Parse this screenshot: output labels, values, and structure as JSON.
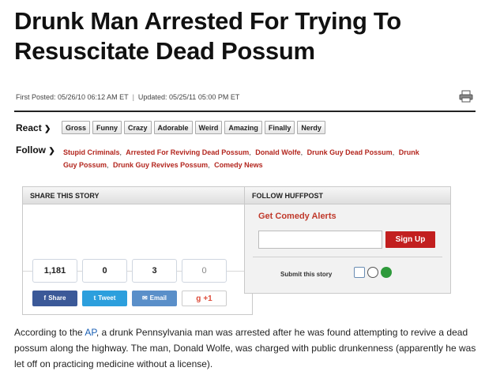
{
  "headline": "Drunk Man Arrested For Trying To Resuscitate Dead Possum",
  "dates": {
    "first_posted": "First Posted: 05/26/10 06:12 AM ET",
    "separator": "|",
    "updated": "Updated: 05/25/11 05:00 PM ET"
  },
  "react": {
    "label": "React",
    "arrow": "❯",
    "tags": [
      "Gross",
      "Funny",
      "Crazy",
      "Adorable",
      "Weird",
      "Amazing",
      "Finally",
      "Nerdy"
    ]
  },
  "follow": {
    "label": "Follow",
    "arrow": "❯",
    "links": [
      "Stupid Criminals",
      "Arrested For Reviving Dead Possum",
      "Donald Wolfe",
      "Drunk Guy Dead Possum",
      "Drunk Guy Possum",
      "Drunk Guy Revives Possum",
      "Comedy News"
    ]
  },
  "share": {
    "title": "SHARE THIS STORY",
    "counts": [
      "1,181",
      "0",
      "3",
      "0"
    ],
    "buttons": [
      {
        "label": "Share",
        "icon_glyph": "f",
        "icon": "facebook-icon",
        "color": "#3b5998"
      },
      {
        "label": "Tweet",
        "icon_glyph": "t",
        "icon": "twitter-icon",
        "color": "#2c9fdd"
      },
      {
        "label": "Email",
        "icon_glyph": "✉",
        "icon": "email-icon",
        "color": "#5a8fc9"
      },
      {
        "label": "+1",
        "icon_glyph": "g",
        "icon": "google-plus-icon",
        "color": "#dd4b39"
      }
    ]
  },
  "huffpost": {
    "title": "FOLLOW HUFFPOST",
    "alerts_title": "Get Comedy Alerts",
    "email_placeholder": "",
    "signup_label": "Sign Up",
    "submit_label": "Submit this story",
    "submit_icons": [
      "digg-icon",
      "reddit-icon",
      "stumbleupon-icon"
    ]
  },
  "article": {
    "intro": "According to the ",
    "source_link": "AP",
    "body": ", a drunk Pennsylvania man was arrested after he was found attempting to revive a dead possum along the highway. The man, Donald Wolfe, was charged with public drunkenness (apparently he was let off on practicing medicine without a license)."
  },
  "colors": {
    "link_red": "#b3261e",
    "signup_red": "#c21f1f",
    "article_link": "#1a5fb4"
  }
}
